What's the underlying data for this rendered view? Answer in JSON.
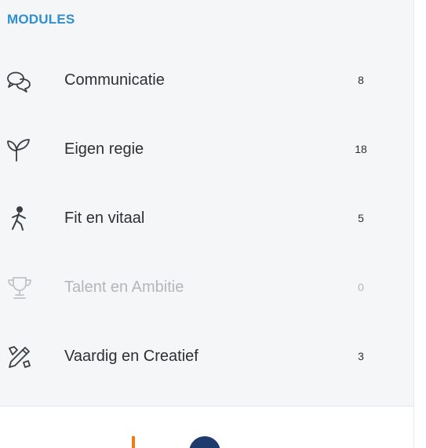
{
  "sidebar": {
    "section_title": "MODULES",
    "items": [
      {
        "label": "Communicatie",
        "count": "8",
        "icon": "chat-bubbles-icon",
        "enabled": true
      },
      {
        "label": "Eigen regie",
        "count": "18",
        "icon": "sprout-icon",
        "enabled": true
      },
      {
        "label": "Fit en vitaal",
        "count": "5",
        "icon": "walking-person-icon",
        "enabled": true
      },
      {
        "label": "Talent en Ambitie",
        "count": "0",
        "icon": "trophy-icon",
        "enabled": false
      },
      {
        "label": "Vaardig en Creatief",
        "count": "3",
        "icon": "pencil-brush-icon",
        "enabled": true
      }
    ]
  },
  "colors": {
    "accent": "#2f8fd0",
    "text": "#2d2f33",
    "disabled": "#b3b7bc",
    "sidebar_bg": "#f4f6f8",
    "footer_orange": "#f07b16",
    "footer_blue": "#1f3b6e"
  }
}
